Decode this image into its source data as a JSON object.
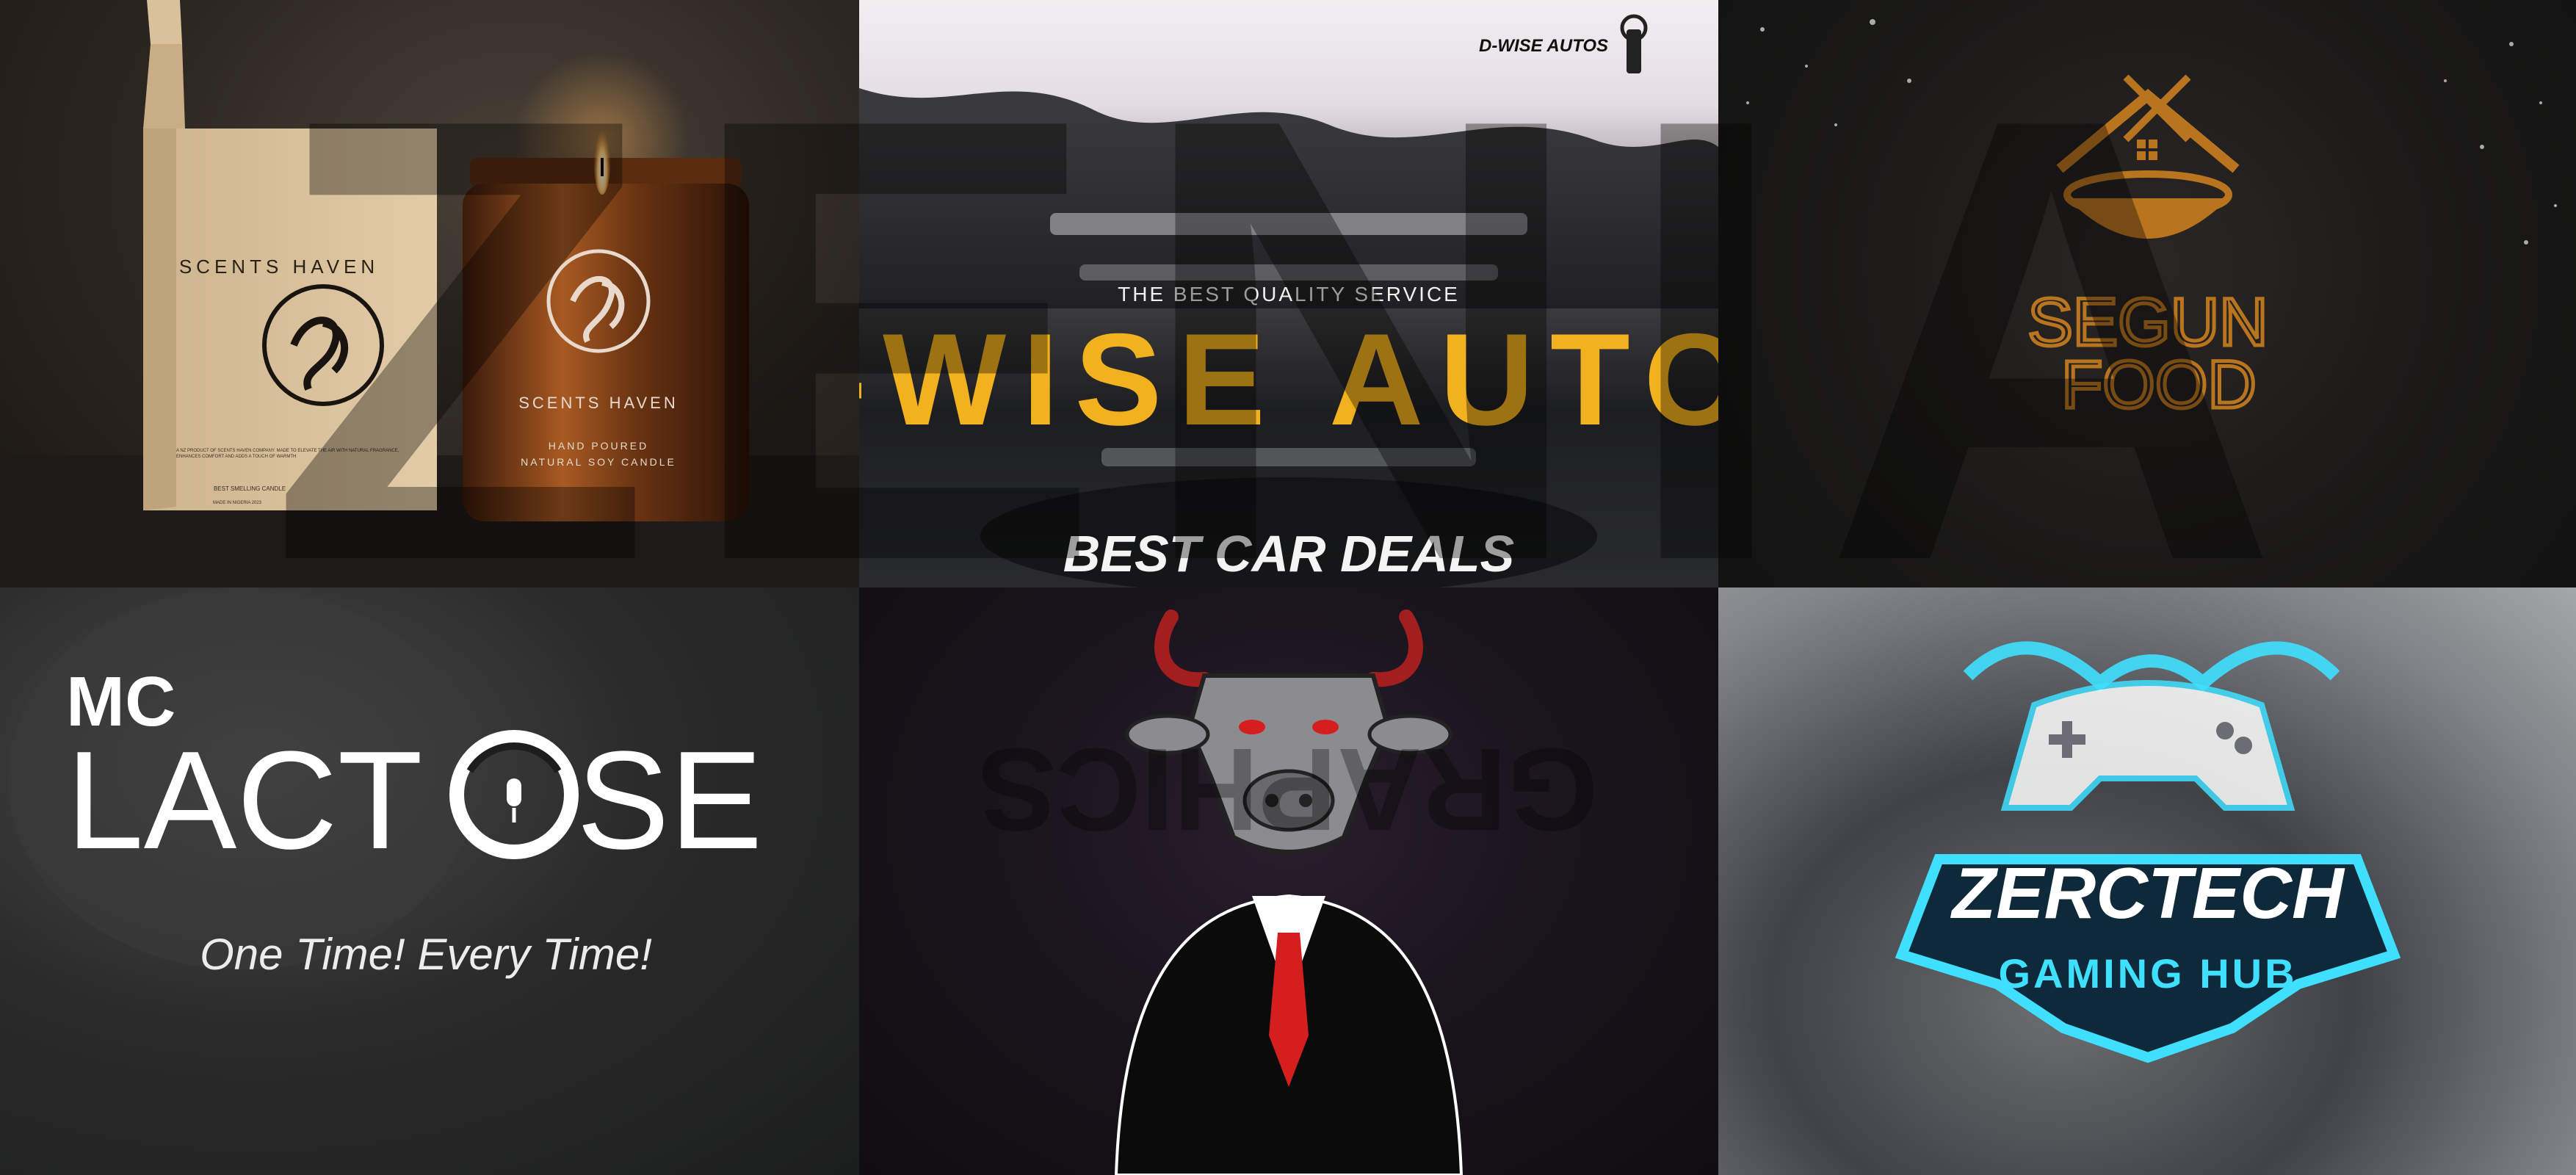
{
  "tiles": {
    "candle": {
      "box_brand": "SCENTS HAVEN",
      "box_fine_print": "A NZ PRODUCT OF SCENTS HAVEN COMPANY. MADE TO ELEVATE THE AIR WITH NATURAL FRAGRANCE, ENHANCES COMFORT AND ADDS A TOUCH OF WARMTH",
      "box_tagline": "BEST SMELLING CANDLE",
      "box_origin": "MADE IN NIGERIA 2023",
      "jar_brand": "SCENTS HAVEN",
      "jar_line1": "HAND POURED",
      "jar_line2": "NATURAL SOY CANDLE"
    },
    "autos": {
      "corner_brand": "D-WISE AUTOS",
      "tagline": "THE BEST QUALITY SERVICE",
      "title": "D-WISE AUTOS",
      "subtitle": "BEST CAR DEALS",
      "title_color": "#f2b11e"
    },
    "food": {
      "word1": "SEGUN",
      "word2": "FOOD",
      "brand_color": "#b8741e"
    },
    "lactose": {
      "word_top": "MC",
      "word_main_left": "LACT",
      "word_main_right": "SE",
      "slogan": "One Time! Every Time!"
    },
    "bull": {
      "mascot": "bull-in-suit-mascot"
    },
    "gaming": {
      "title": "ZERCTECH",
      "subtitle": "GAMING HUB",
      "accent_color": "#3fe0ff"
    }
  },
  "watermark": {
    "text": "ZENIA",
    "subtext": "GRAPHICS"
  }
}
